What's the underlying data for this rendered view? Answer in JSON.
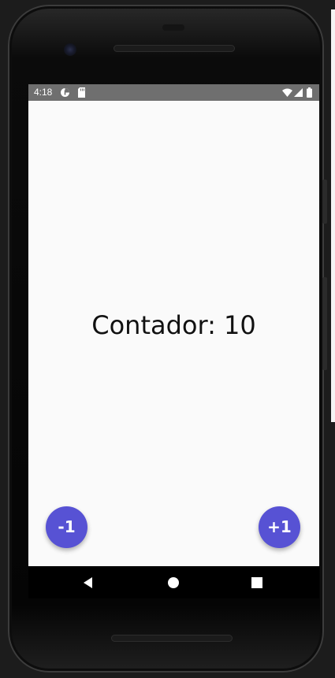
{
  "status_bar": {
    "time": "4:18",
    "icons": [
      "data-saver-icon",
      "sd-card-icon",
      "wifi-icon",
      "signal-icon",
      "battery-icon"
    ]
  },
  "main": {
    "counter_text": "Contador: 10"
  },
  "buttons": {
    "decrement_label": "-1",
    "increment_label": "+1"
  },
  "nav_bar": {
    "items": [
      "back-icon",
      "home-icon",
      "recents-icon"
    ]
  },
  "colors": {
    "fab": "#5752d4",
    "status_bar": "#6f6f6f",
    "background": "#fafafa"
  }
}
